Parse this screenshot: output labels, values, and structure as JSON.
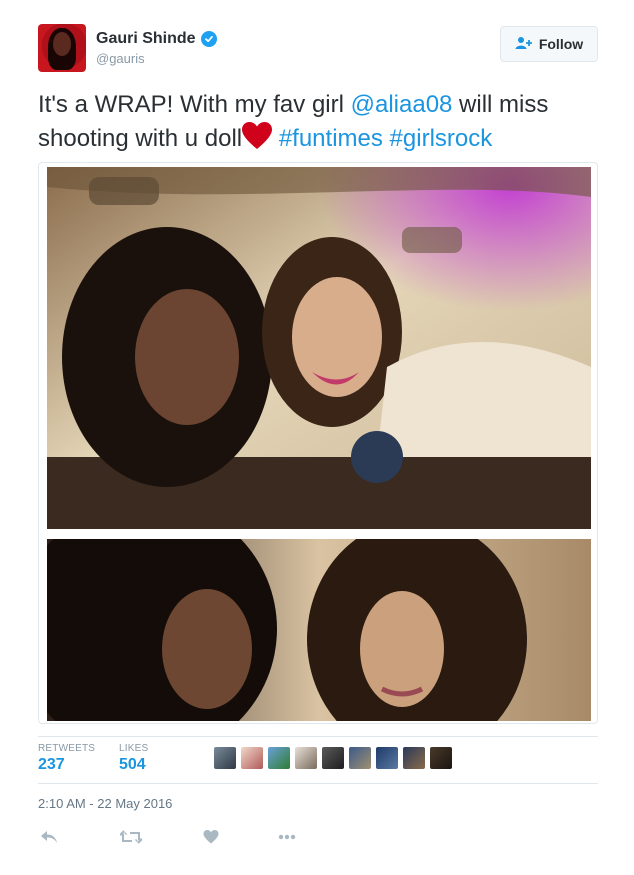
{
  "user": {
    "name": "Gauri Shinde",
    "handle": "@gauris",
    "verified_icon": "verified-badge-icon"
  },
  "follow_button": {
    "label": "Follow",
    "icon": "follow-person-plus-icon"
  },
  "tweet": {
    "text_parts": {
      "p1": "It's  a WRAP! With my fav girl ",
      "mention": "@aliaa08",
      "p2": " will miss shooting with u doll",
      "heart": "heart-emoji-icon",
      "tag1": "#funtimes",
      "tag2": "#girlsrock"
    },
    "media_icons": [
      "photo-top",
      "photo-bottom"
    ]
  },
  "stats": {
    "retweets_label": "RETWEETS",
    "retweets": "237",
    "likes_label": "LIKES",
    "likes": "504"
  },
  "timestamp": "2:10 AM - 22 May 2016",
  "actions": [
    "reply-icon",
    "retweet-icon",
    "like-icon",
    "more-icon"
  ],
  "colors": {
    "link": "#1b95e0",
    "text": "#292f33",
    "muted": "#8899a6",
    "border": "#e1e8ed",
    "verified": "#1da1f2",
    "heart": "#d0021b"
  }
}
